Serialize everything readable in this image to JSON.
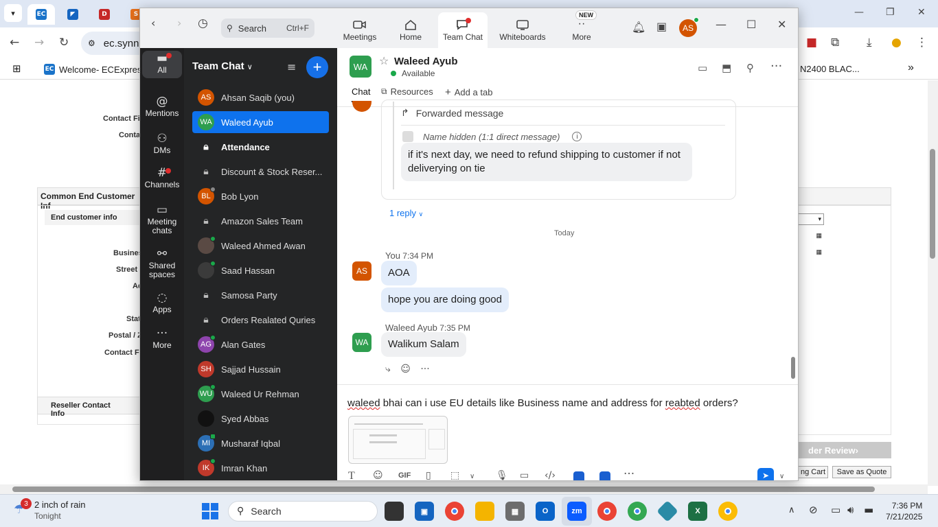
{
  "browser": {
    "address": "ec.synn",
    "bookmark_1": "Welcome- ECExpres...",
    "bookmark_right": "N2400 BLAC..."
  },
  "page": {
    "labels": [
      "Contact Fir",
      "Contac",
      "Busines",
      "Street A",
      "Ad",
      "Stat",
      "Postal / Zi",
      "Contact Fu"
    ],
    "section_common": "Common End Customer Inf",
    "section_end_customer": "End customer info",
    "section_reseller": "Reseller Contact Info",
    "btn_review": "der Review",
    "btn_cart": "ng Cart",
    "btn_quote": "Save as Quote"
  },
  "zoom": {
    "search_placeholder": "Search",
    "search_shortcut": "Ctrl+F",
    "tabs": {
      "meetings": "Meetings",
      "home": "Home",
      "team_chat": "Team Chat",
      "whiteboards": "Whiteboards",
      "more": "More",
      "new_badge": "NEW"
    },
    "user_initials": "AS",
    "rail": {
      "all": "All",
      "mentions": "Mentions",
      "dms": "DMs",
      "channels": "Channels",
      "meeting_chats_1": "Meeting",
      "meeting_chats_2": "chats",
      "shared_1": "Shared",
      "shared_2": "spaces",
      "apps": "Apps",
      "more": "More"
    },
    "list_title": "Team Chat",
    "chats": [
      {
        "initials": "AS",
        "name": "Ahsan Saqib (you)"
      },
      {
        "initials": "WA",
        "name": "Waleed Ayub"
      },
      {
        "initials": "",
        "name": "Attendance"
      },
      {
        "initials": "",
        "name": "Discount & Stock Reser..."
      },
      {
        "initials": "BL",
        "name": "Bob Lyon"
      },
      {
        "initials": "",
        "name": "Amazon Sales Team"
      },
      {
        "initials": "",
        "name": "Waleed Ahmed Awan"
      },
      {
        "initials": "",
        "name": "Saad Hassan"
      },
      {
        "initials": "",
        "name": "Samosa Party"
      },
      {
        "initials": "",
        "name": "Orders Realated Quries"
      },
      {
        "initials": "AG",
        "name": "Alan Gates"
      },
      {
        "initials": "SH",
        "name": "Sajjad Hussain"
      },
      {
        "initials": "WU",
        "name": "Waleed Ur Rehman"
      },
      {
        "initials": "",
        "name": "Syed Abbas"
      },
      {
        "initials": "MI",
        "name": "Musharaf Iqbal"
      },
      {
        "initials": "IK",
        "name": "Imran Khan"
      }
    ],
    "chat": {
      "contact_initials": "WA",
      "contact_name": "Waleed Ayub",
      "contact_status": "Available",
      "tab_chat": "Chat",
      "tab_resources": "Resources",
      "tab_add": "Add a tab",
      "forwarded_label": "Forwarded message",
      "hidden_name": "Name hidden (1:1 direct message)",
      "forwarded_text": "if it's next day, we need to refund shipping to customer if not deliverying on tie",
      "reply_link": "1 reply",
      "day_sep": "Today",
      "you_label": "You",
      "you_time": "7:34 PM",
      "msg1": "AOA",
      "msg2": "hope you are doing good",
      "contact_time": "7:35 PM",
      "msg3": "Walikum Salam",
      "compose_pre": "waleed",
      "compose_mid": " bhai can i use EU details like Business name and address for ",
      "compose_err": "reabted",
      "compose_post": " orders?",
      "gif_label": "GIF"
    }
  },
  "taskbar": {
    "weather_badge": "3",
    "weather_line1": "2 inch of rain",
    "weather_line2": "Tonight",
    "search": "Search",
    "time": "7:36 PM",
    "date": "7/21/2025"
  }
}
